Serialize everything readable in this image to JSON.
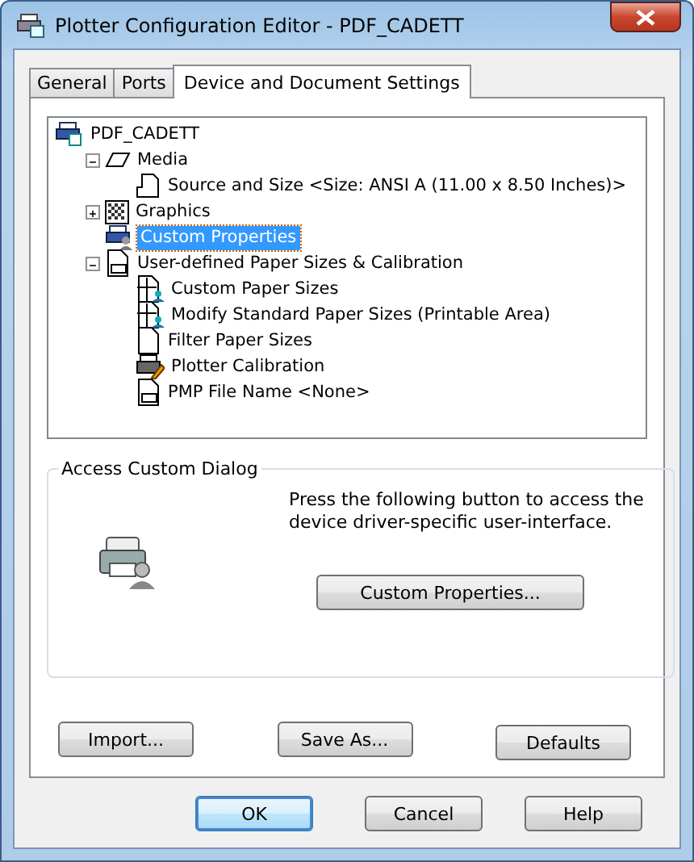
{
  "window": {
    "title": "Plotter Configuration Editor - PDF_CADETT"
  },
  "tabs": [
    {
      "label": "General",
      "selected": false
    },
    {
      "label": "Ports",
      "selected": false
    },
    {
      "label": "Device and Document Settings",
      "selected": true
    }
  ],
  "tree": [
    {
      "label": "PDF_CADETT",
      "kind": "plotter",
      "selected": false,
      "children": [
        {
          "label": "Media",
          "kind": "media",
          "selected": false,
          "expanded": true,
          "children": [
            {
              "label": "Source and Size <Size: ANSI A (11.00 x 8.50 Inches)>",
              "kind": "tray",
              "selected": false
            }
          ]
        },
        {
          "label": "Graphics",
          "kind": "graphics",
          "selected": false,
          "expanded": false
        },
        {
          "label": "Custom Properties",
          "kind": "custom",
          "selected": true
        },
        {
          "label": "User-defined Paper Sizes & Calibration",
          "kind": "userpaper",
          "selected": false,
          "expanded": true,
          "children": [
            {
              "label": "Custom Paper Sizes",
              "kind": "sizes",
              "selected": false
            },
            {
              "label": "Modify Standard Paper Sizes (Printable Area)",
              "kind": "sizes",
              "selected": false
            },
            {
              "label": "Filter Paper Sizes",
              "kind": "page",
              "selected": false
            },
            {
              "label": "Plotter Calibration",
              "kind": "calibration",
              "selected": false
            },
            {
              "label": "PMP File Name <None>",
              "kind": "userpaper",
              "selected": false
            }
          ]
        }
      ]
    }
  ],
  "group": {
    "title": "Access Custom Dialog",
    "text": "Press the following button to access the device driver-specific user-interface.",
    "button": "Custom Properties..."
  },
  "panel_buttons": [
    "Import...",
    "Save As...",
    "Defaults"
  ],
  "dialog_buttons": [
    {
      "label": "OK",
      "default": true
    },
    {
      "label": "Cancel",
      "default": false
    },
    {
      "label": "Help",
      "default": false
    }
  ]
}
